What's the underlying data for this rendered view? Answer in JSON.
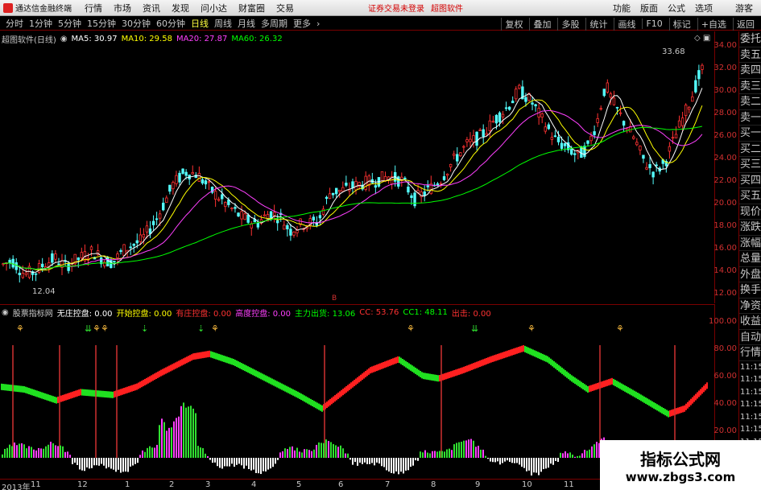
{
  "menubar": {
    "app_title": "通达信金融终端",
    "items": [
      "行情",
      "市场",
      "资讯",
      "发现",
      "问小达",
      "财富圈",
      "交易"
    ],
    "notice": "证券交易未登录",
    "brand": "超图软件",
    "right_items": [
      "功能",
      "版面",
      "公式",
      "选项"
    ],
    "guest": "游客"
  },
  "periodbar": {
    "periods": [
      "分时",
      "1分钟",
      "5分钟",
      "15分钟",
      "30分钟",
      "60分钟",
      "日线",
      "周线",
      "月线",
      "多周期",
      "更多"
    ],
    "active": "日线",
    "tools": [
      "复权",
      "叠加",
      "多股",
      "统计",
      "画线",
      "F10",
      "标记",
      "+自选",
      "返回"
    ]
  },
  "price_legend": {
    "name": "超图软件(日线)",
    "ma5": "MA5: 30.97",
    "ma10": "MA10: 29.58",
    "ma20": "MA20: 27.87",
    "ma60": "MA60: 26.32"
  },
  "price_annotations": {
    "high": "33.68",
    "low": "12.04"
  },
  "indicator_legend": {
    "name": "股票指标网",
    "f1": "无庄控盘: 0.00",
    "f2": "开始控盘: 0.00",
    "f3": "有庄控盘: 0.00",
    "f4": "高度控盘: 0.00",
    "f5": "主力出货: 13.06",
    "f6": "CC: 53.76",
    "f7": "CC1: 48.11",
    "f8": "出击: 0.00"
  },
  "price_axis_ticks": [
    "34.00",
    "32.00",
    "30.00",
    "28.00",
    "26.00",
    "24.00",
    "22.00",
    "20.00",
    "18.00",
    "16.00",
    "14.00",
    "12.00"
  ],
  "indicator_axis_ticks": [
    "100.00",
    "80.00",
    "60.00",
    "40.00",
    "20.00"
  ],
  "sidetabs": [
    "委托",
    "卖五",
    "卖四",
    "卖三",
    "卖二",
    "卖一",
    "买一",
    "买二",
    "买三",
    "买四",
    "买五",
    "现价",
    "涨跌",
    "涨幅",
    "总量",
    "外盘",
    "换手",
    "净资",
    "收益"
  ],
  "sidetabs2": [
    "自动",
    "行情"
  ],
  "side_times": [
    "11:15",
    "11:15",
    "11:15",
    "11:15",
    "11:15",
    "11:15",
    "11:15",
    "11:15",
    "11:15"
  ],
  "date_labels": [
    "2013年",
    "11",
    "12",
    "1",
    "2",
    "3",
    "4",
    "5",
    "6",
    "7",
    "8",
    "9",
    "10",
    "11"
  ],
  "watermark": {
    "line1": "指标公式网",
    "line2": "www.zbgs3.com"
  },
  "colors": {
    "up": "#ff3232",
    "down": "#54ffff",
    "ma5": "#ffffff",
    "ma10": "#ffff00",
    "ma20": "#ff40ff",
    "ma60": "#00ff00",
    "accent": "#d03030"
  }
}
